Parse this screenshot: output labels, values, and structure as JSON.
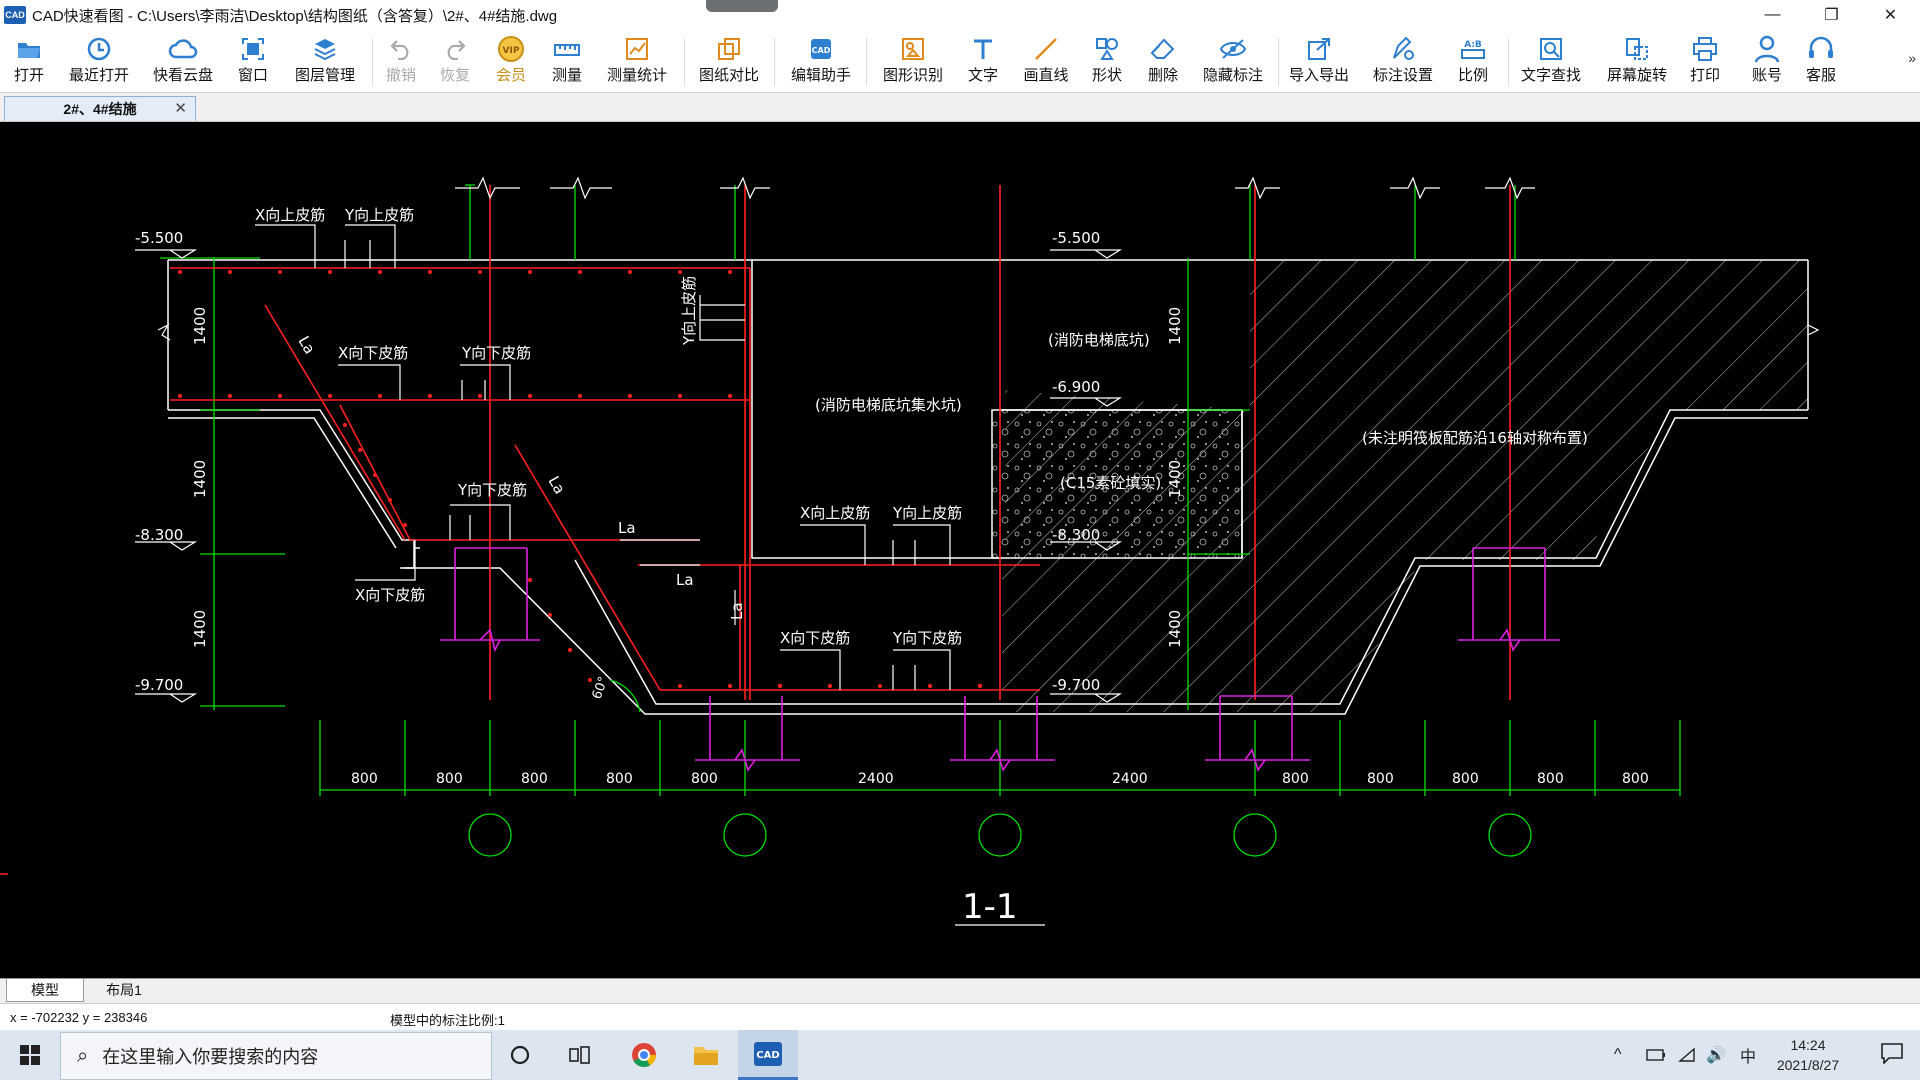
{
  "window": {
    "title": "CAD快速看图 - C:\\Users\\李雨洁\\Desktop\\结构图纸（含答复）\\2#、4#结施.dwg",
    "logo_text": "CAD",
    "minimize": "—",
    "restore": "❐",
    "close": "✕"
  },
  "toolbar": {
    "items": [
      {
        "label": "打开",
        "icon": "folder-open-icon"
      },
      {
        "label": "最近打开",
        "icon": "clock-history-icon"
      },
      {
        "label": "快看云盘",
        "icon": "cloud-icon"
      },
      {
        "label": "窗口",
        "icon": "window-fit-icon"
      },
      {
        "label": "图层管理",
        "icon": "layers-icon"
      },
      {
        "label": "撤销",
        "icon": "undo-icon",
        "disabled": true
      },
      {
        "label": "恢复",
        "icon": "redo-icon",
        "disabled": true
      },
      {
        "label": "会员",
        "icon": "vip-icon"
      },
      {
        "label": "测量",
        "icon": "ruler-icon"
      },
      {
        "label": "测量统计",
        "icon": "measure-stats-icon"
      },
      {
        "label": "图纸对比",
        "icon": "compare-icon"
      },
      {
        "label": "编辑助手",
        "icon": "edit-assistant-icon"
      },
      {
        "label": "图形识别",
        "icon": "shape-recognize-icon"
      },
      {
        "label": "文字",
        "icon": "text-icon"
      },
      {
        "label": "画直线",
        "icon": "line-icon"
      },
      {
        "label": "形状",
        "icon": "shapes-icon"
      },
      {
        "label": "删除",
        "icon": "eraser-icon"
      },
      {
        "label": "隐藏标注",
        "icon": "eye-hide-icon"
      },
      {
        "label": "导入导出",
        "icon": "import-export-icon"
      },
      {
        "label": "标注设置",
        "icon": "annotation-settings-icon"
      },
      {
        "label": "比例",
        "icon": "scale-icon"
      },
      {
        "label": "文字查找",
        "icon": "text-search-icon"
      },
      {
        "label": "屏幕旋转",
        "icon": "rotate-screen-icon"
      },
      {
        "label": "打印",
        "icon": "printer-icon"
      },
      {
        "label": "账号",
        "icon": "user-icon"
      },
      {
        "label": "客服",
        "icon": "headset-icon"
      }
    ],
    "more": "»"
  },
  "tab": {
    "label": "2#、4#结施",
    "close": "✕"
  },
  "drawing": {
    "level_labels": [
      "-5.500",
      "-5.500",
      "-6.900",
      "-8.300",
      "-8.300",
      "-9.700",
      "-9.700"
    ],
    "rebar_labels": {
      "x_top": "X向上皮筋",
      "y_top": "Y向上皮筋",
      "x_bottom": "X向下皮筋",
      "y_bottom": "Y向下皮筋",
      "la": "La"
    },
    "vertical_dims": [
      "1400",
      "1400",
      "1400",
      "1400",
      "1400",
      "1400"
    ],
    "notes": {
      "sump": "(消防电梯底坑集水坑)",
      "pit": "(消防电梯底坑)",
      "concrete": "(C15素砼填实)",
      "unmarked": "(未注明筏板配筋沿16轴对称布置)"
    },
    "angle": "60°",
    "horizontal_dims": [
      "800",
      "800",
      "800",
      "800",
      "800",
      "2400",
      "2400",
      "800",
      "800",
      "800",
      "800",
      "800"
    ],
    "section_title": "1-1"
  },
  "layout_tabs": [
    {
      "label": "模型",
      "active": true
    },
    {
      "label": "布局1",
      "active": false
    }
  ],
  "status": {
    "coords": "x = -702232  y = 238346",
    "scale_text": "模型中的标注比例:1"
  },
  "taskbar": {
    "search_placeholder": "在这里输入你要搜索的内容",
    "ime": "中",
    "time": "14:24",
    "date": "2021/8/27"
  }
}
